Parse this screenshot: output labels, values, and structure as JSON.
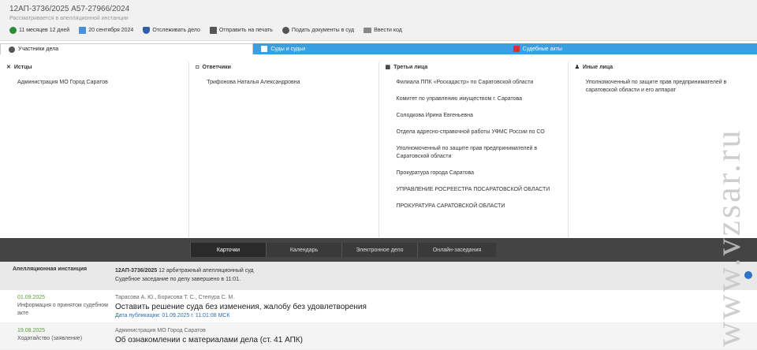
{
  "header": {
    "case_title": "12АП-3736/2025   А57-27966/2024",
    "case_subtitle": "Рассматривается в апелляционной инстанции",
    "actions": [
      {
        "label": "11 месяцев 12 дней",
        "icon": "clock-icon"
      },
      {
        "label": "20 сентября 2024",
        "icon": "calendar-icon"
      },
      {
        "label": "Отслеживать дело",
        "icon": "shield-icon"
      },
      {
        "label": "Отправить на печать",
        "icon": "print-icon"
      },
      {
        "label": "Подать документы в суд",
        "icon": "document-icon"
      },
      {
        "label": "Ввести код",
        "icon": "code-icon"
      }
    ]
  },
  "tabs": [
    {
      "label": "Участники дела",
      "active": true
    },
    {
      "label": "Суды и судьи",
      "active": false
    },
    {
      "label": "Судебные акты",
      "active": false
    }
  ],
  "parties": {
    "plaintiffs": {
      "heading": "Истцы",
      "items": [
        "Администрация МО Город Саратов"
      ]
    },
    "defendants": {
      "heading": "Ответчики",
      "items": [
        "Трифонова Наталья Александровна"
      ]
    },
    "third_parties": {
      "heading": "Третьи лица",
      "items": [
        "Филиала ППК «Роскадастр» по Саратовской области",
        "Комитет по управлению имуществом г. Саратова",
        "Солодкова Ирина Евгеньевна",
        "Отдела адресно-справочной работы УФМС России по СО",
        "Уполномоченный по защите прав предпринимателей в Саратовской области",
        "Прокуратура города Саратова",
        "УПРАВЛЕНИЕ РОСРЕЕСТРА ПОСАРАТОВСКОЙ ОБЛАСТИ",
        "ПРОКУРАТУРА САРАТОВСКОЙ ОБЛАСТИ"
      ]
    },
    "others": {
      "heading": "Иные лица",
      "items": [
        "Уполномоченный по защите прав предпринимателей в саратовской области и его аппарат"
      ]
    }
  },
  "nav": {
    "cards": "Карточки",
    "calendar": "Календарь",
    "electronic": "Электронное дело",
    "online": "Онлайн-заседания"
  },
  "instance": {
    "label": "Апелляционная инстанция",
    "case": "12АП-3736/2025",
    "court": "12 арбитражный апелляционный суд",
    "status": "Судебное заседание по делу завершено в 11:01."
  },
  "events": [
    {
      "date": "01.09.2025",
      "type": "Информация о принятом судебном акте",
      "who": "Тарасова А. Ю., Борисова Т. С., Степура С. М.",
      "title": "Оставить решение суда без изменения, жалобу без удовлетворения",
      "pub": "Дата публикации: 01.09.2025 г. 11:01:08 МСК"
    },
    {
      "date": "19.08.2025",
      "type": "Ходатайство (заявление)",
      "who": "Администрация МО Город Саратов",
      "title": "Об ознакомлении с материалами дела (ст. 41 АПК)",
      "pub": ""
    }
  ],
  "watermark": "www.vzsar.ru",
  "colors": {
    "tab_blue": "#3a9ee0",
    "dark_bar": "#444444",
    "date_green": "#5d9b38",
    "link_blue": "#2a6ebb"
  }
}
